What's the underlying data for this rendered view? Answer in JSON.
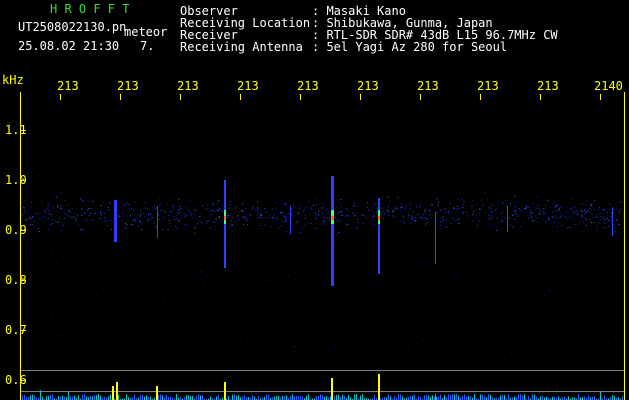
{
  "header": {
    "app_name": "H R O F F T",
    "filename": "UT2508022130.pn",
    "meteor_label": "meteor",
    "datetime": "25.08.02 21:30",
    "count": "7.",
    "fields": [
      {
        "label": "Observer",
        "value": ": Masaki Kano"
      },
      {
        "label": "Receiving Location",
        "value": ": Shibukawa, Gunma, Japan"
      },
      {
        "label": "Receiver",
        "value": ": RTL-SDR SDR# 43dB L15 96.7MHz CW"
      },
      {
        "label": "Receiving Antenna",
        "value": ": 5el Yagi Az 280 for Seoul"
      }
    ]
  },
  "axes": {
    "y_unit": "kHz",
    "y_ticks": [
      "1.1",
      "1.0",
      "0.9",
      "0.8",
      "0.7",
      "0.6"
    ],
    "x_ticks": [
      "213",
      "213",
      "213",
      "213",
      "213",
      "213",
      "213",
      "213",
      "213",
      "2140"
    ]
  },
  "colors": {
    "grid": "#808080",
    "label": "#ffff00",
    "title": "#33e033",
    "text": "#ffffff",
    "signal": "#3040ff"
  },
  "chart_data": {
    "type": "heatmap",
    "y_unit": "kHz",
    "y_ticks": [
      "1.1",
      "1.0",
      "0.9",
      "0.8",
      "0.7",
      "0.6"
    ],
    "x_ticks": [
      "213",
      "213",
      "213",
      "213",
      "213",
      "213",
      "213",
      "213",
      "213",
      "2140"
    ],
    "carrier_khz": 0.93
  }
}
